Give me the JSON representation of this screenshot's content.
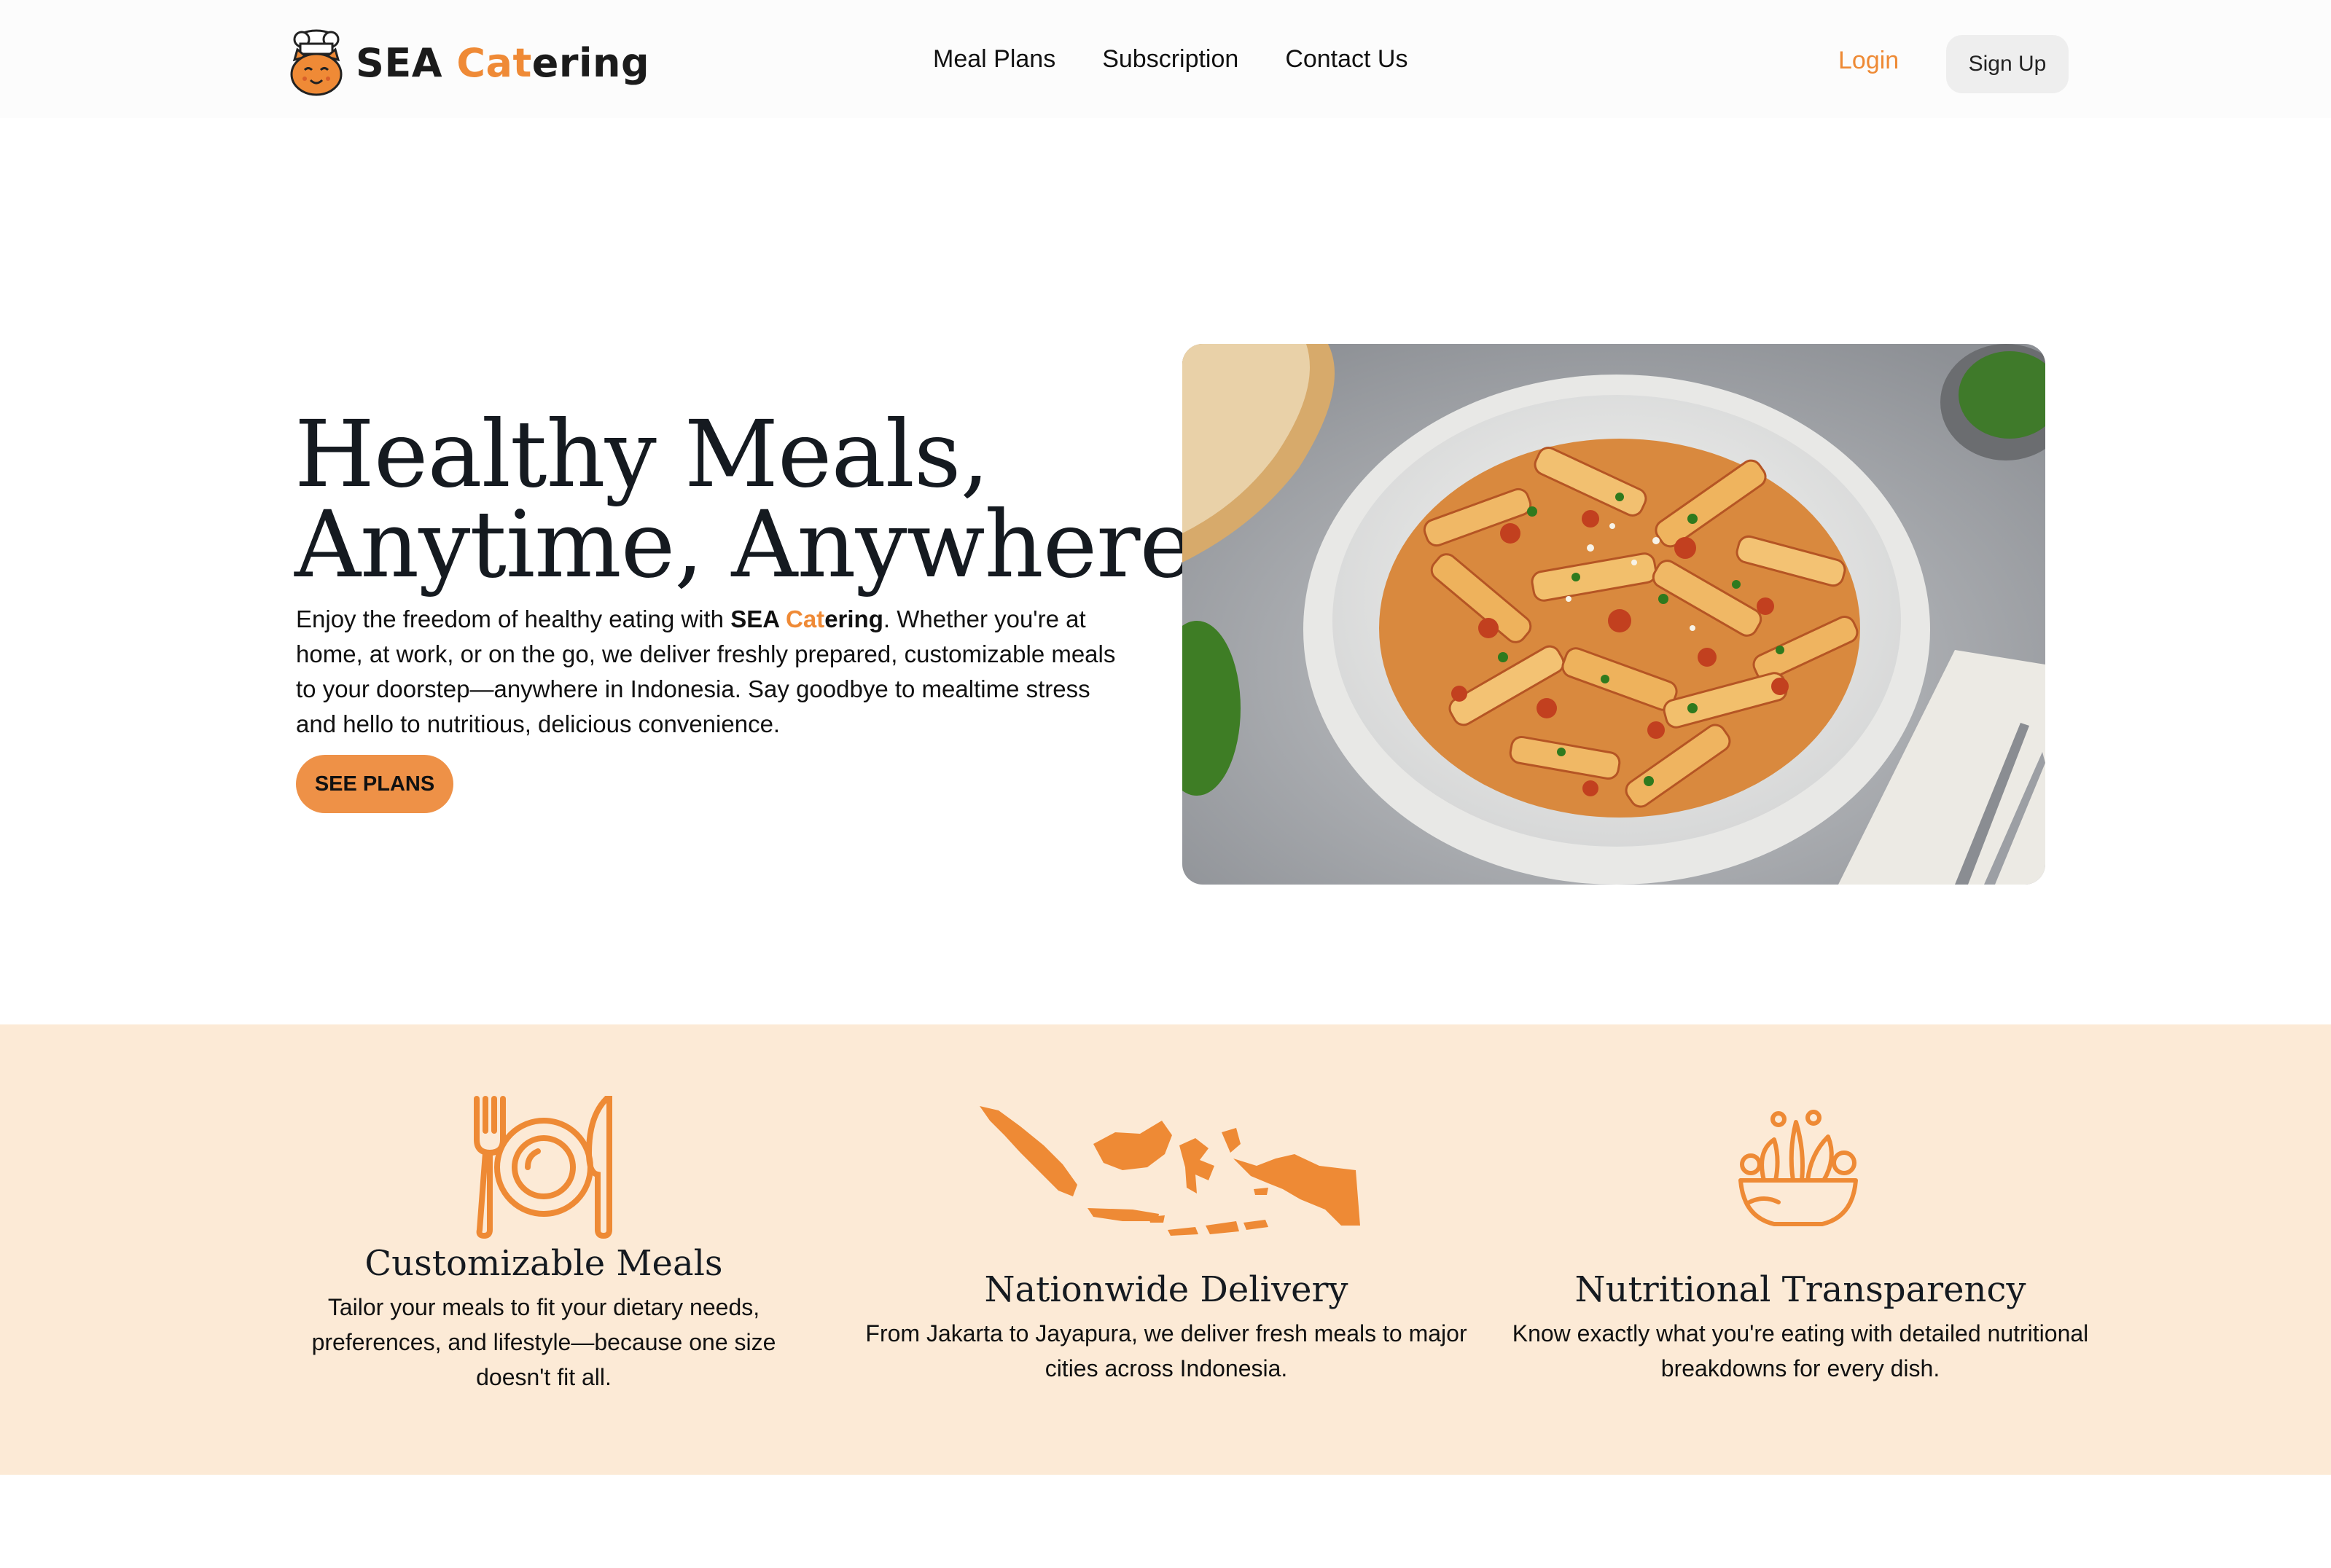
{
  "brand": {
    "name_part1": "SEA ",
    "name_cat": "Cat",
    "name_rest": "ering",
    "accent": "#ef8a36"
  },
  "nav": {
    "items": [
      "Meal Plans",
      "Subscription",
      "Contact Us"
    ],
    "login": "Login",
    "signup": "Sign Up"
  },
  "hero": {
    "title_line1": "Healthy Meals,",
    "title_line2": "Anytime, Anywhere",
    "text_before": "Enjoy the freedom of healthy eating with ",
    "brand_sea": "SEA ",
    "brand_cat": "Cat",
    "brand_ering": "ering",
    "text_after": ". Whether you're at home, at work, or on the go, we deliver freshly prepared, customizable meals to your doorstep—anywhere in Indonesia. Say goodbye to mealtime stress and hello to nutritious, delicious convenience.",
    "cta": "SEE PLANS",
    "image_icon": "penne-pasta-bowl-photo"
  },
  "features": [
    {
      "icon": "plate-fork-knife-icon",
      "title": "Customizable Meals",
      "desc": "Tailor your meals to fit your dietary needs, preferences, and lifestyle—because one size doesn't fit all."
    },
    {
      "icon": "indonesia-map-icon",
      "title": "Nationwide Delivery",
      "desc": "From Jakarta to Jayapura, we deliver fresh meals to major cities across Indonesia."
    },
    {
      "icon": "salad-bowl-icon",
      "title": "Nutritional Transparency",
      "desc": "Know exactly what you're eating with detailed nutritional breakdowns for every dish."
    }
  ],
  "colors": {
    "features_bg": "#fcead6",
    "cta_bg": "#ee9147",
    "icon": "#ee8a35"
  }
}
